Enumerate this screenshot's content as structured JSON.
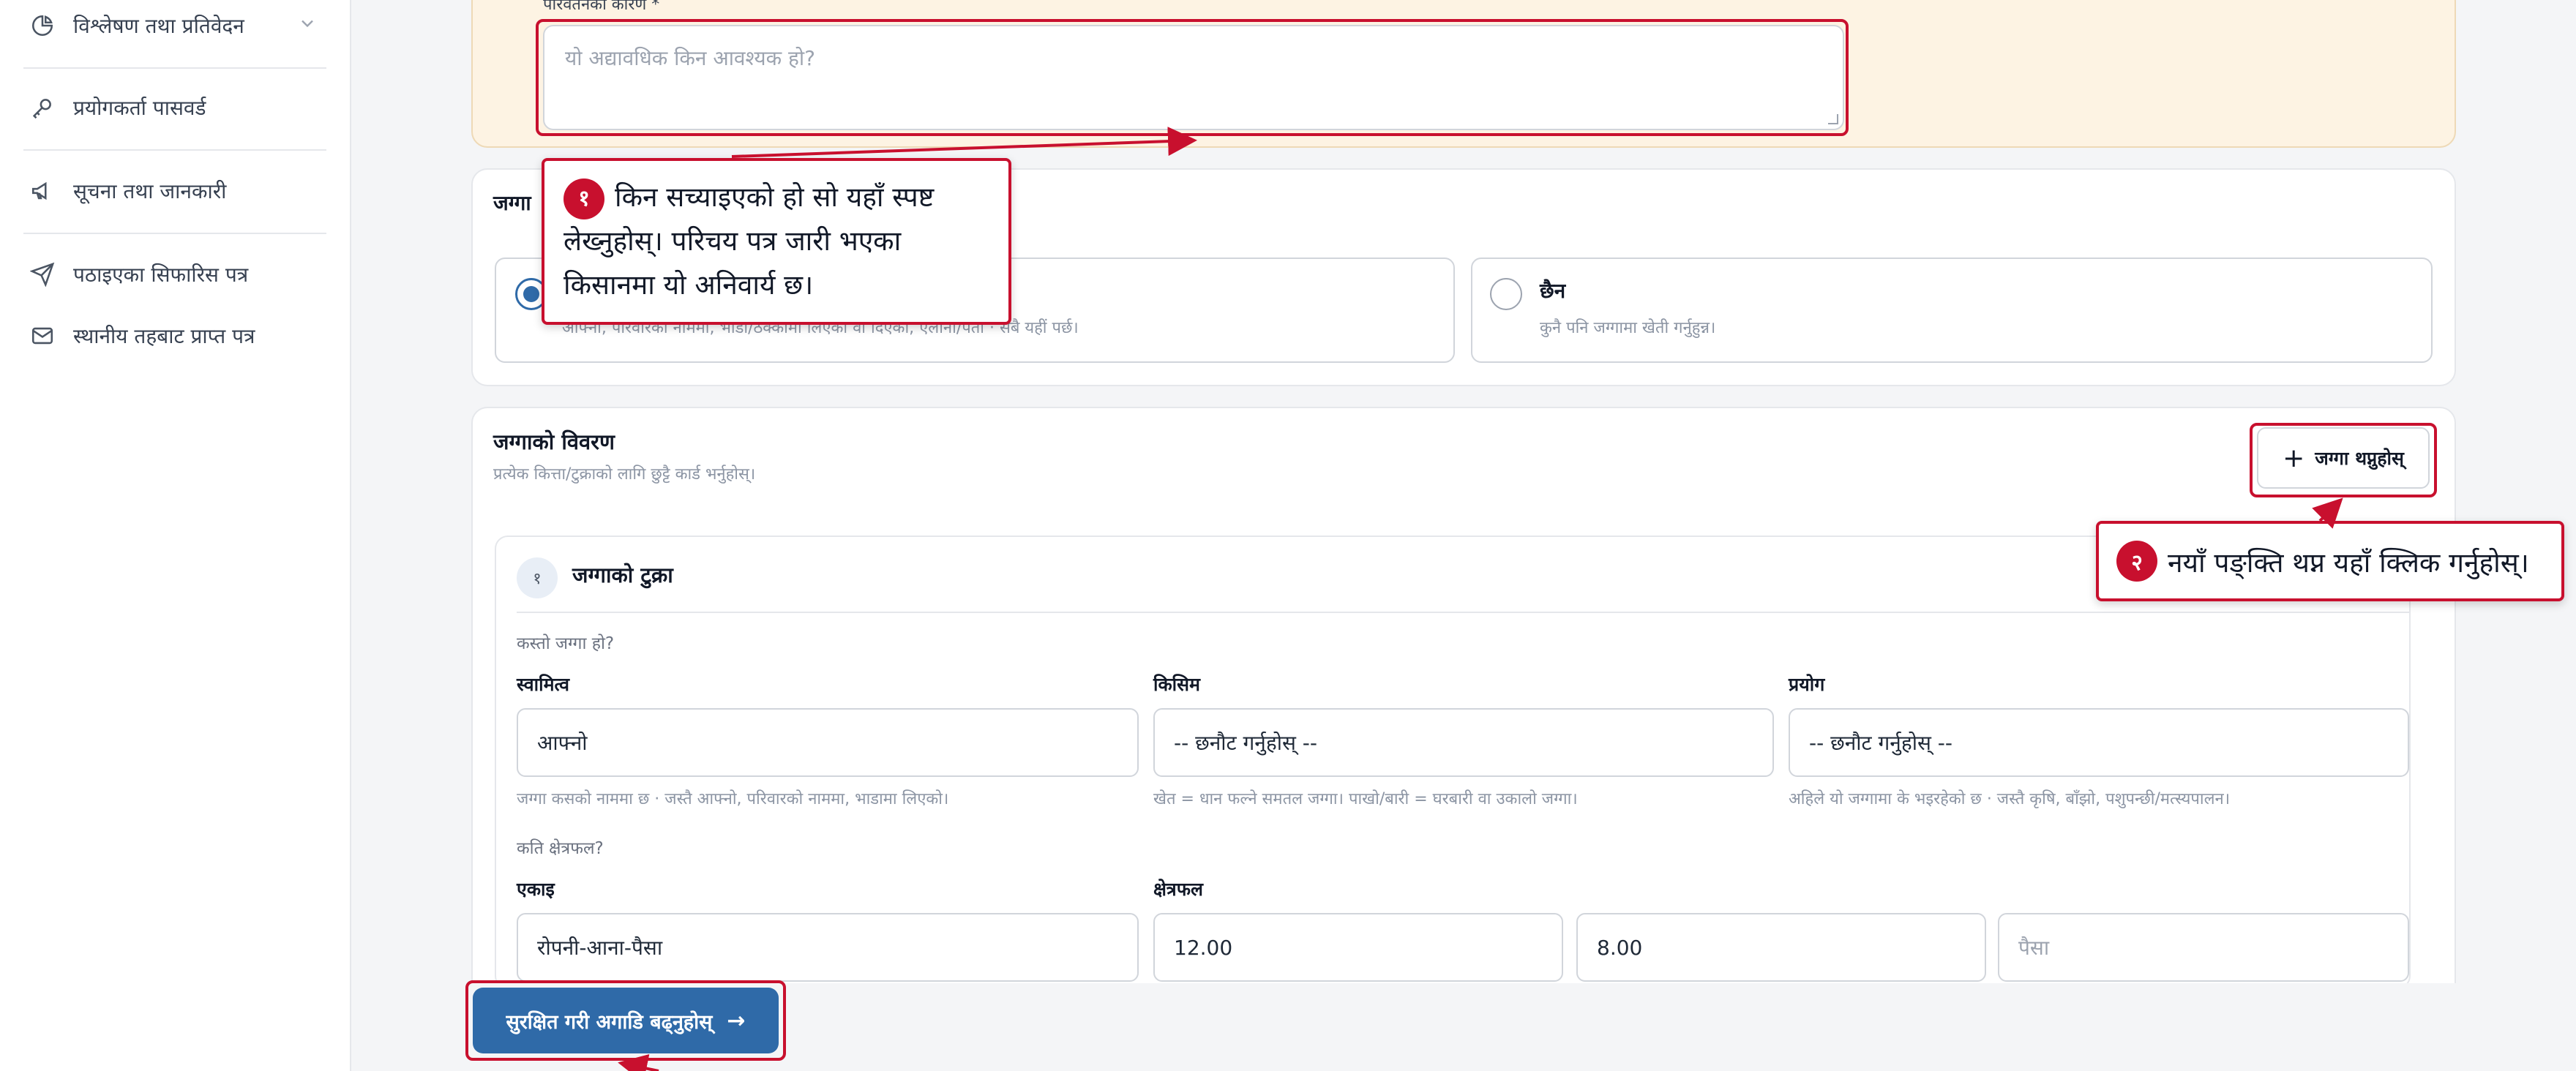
{
  "sidebar": {
    "items": [
      {
        "label": "विश्लेषण तथा प्रतिवेदन",
        "icon": "pie-chart-icon",
        "has_chevron": true
      },
      {
        "label": "प्रयोगकर्ता पासवर्ड",
        "icon": "key-icon"
      },
      {
        "label": "सूचना तथा जानकारी",
        "icon": "megaphone-icon"
      },
      {
        "label": "पठाइएका सिफारिस पत्र",
        "icon": "send-icon"
      },
      {
        "label": "स्थानीय तहबाट प्राप्त पत्र",
        "icon": "mail-icon"
      }
    ]
  },
  "reason": {
    "label": "परिवर्तनको कारण *",
    "placeholder": "यो अद्यावधिक किन आवश्यक हो?"
  },
  "land_question": {
    "title": "जग्गा",
    "options": [
      {
        "title": "",
        "hint": "आफ्नो, परिवारको नाममा, भाडा/ठेक्कामा लिएको वा दिएको, ऐलानी/पर्ती · सबै यहीं पर्छ।",
        "selected": true
      },
      {
        "title": "छैन",
        "hint": "कुनै पनि जग्गामा खेती गर्नुहुन्न।",
        "selected": false
      }
    ]
  },
  "land_details": {
    "title": "जग्गाको विवरण",
    "subtitle": "प्रत्येक कित्ता/टुक्राको लागि छुट्टै कार्ड भर्नुहोस्।",
    "add_button": "जग्गा थप्नुहोस्",
    "parcel": {
      "number": "१",
      "title": "जग्गाको टुक्रा",
      "question_type": "कस्तो जग्गा हो?",
      "ownership": {
        "label": "स्वामित्व",
        "value": "आफ्नो",
        "help": "जग्गा कसको नाममा छ · जस्तै आफ्नो, परिवारको नाममा, भाडामा लिएको।"
      },
      "kind": {
        "label": "किसिम",
        "value": "-- छनौट गर्नुहोस् --",
        "help": "खेत = धान फल्ने समतल जग्गा। पाखो/बारी = घरबारी वा उकालो जग्गा।"
      },
      "use": {
        "label": "प्रयोग",
        "value": "-- छनौट गर्नुहोस् --",
        "help": "अहिले यो जग्गामा के भइरहेको छ · जस्तै कृषि, बाँझो, पशुपन्छी/मत्स्यपालन।"
      },
      "question_area": "कति क्षेत्रफल?",
      "unit": {
        "label": "एकाइ",
        "value": "रोपनी-आना-पैसा"
      },
      "area": {
        "label": "क्षेत्रफल",
        "ropani": "12.00",
        "aana": "8.00",
        "paisa_placeholder": "पैसा"
      }
    }
  },
  "submit_button": "सुरक्षित गरी अगाडि बढ्नुहोस्",
  "callouts": {
    "one": {
      "num": "१",
      "text": "किन सच्याइएको हो सो यहाँ स्पष्ट लेख्नुहोस्। परिचय पत्र जारी भएका किसानमा यो अनिवार्य छ।"
    },
    "two": {
      "num": "२",
      "text": "नयाँ पङ्क्ति थप्न यहाँ क्लिक गर्नुहोस्।"
    }
  },
  "colors": {
    "accent": "#2f6aa8",
    "annotation": "#c8102e",
    "warning_bg": "#fdf3e3"
  }
}
